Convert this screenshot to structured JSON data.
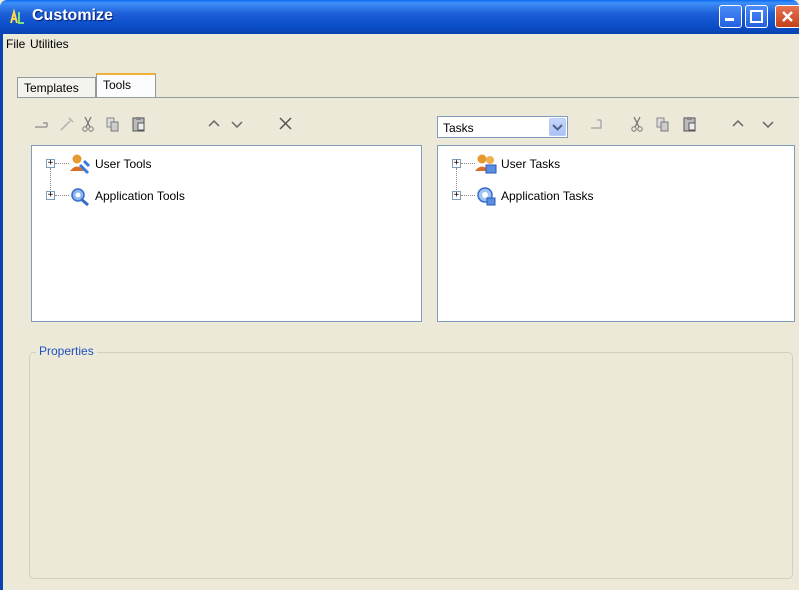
{
  "window": {
    "title": "Customize"
  },
  "menu": {
    "items": [
      "File",
      "Utilities"
    ]
  },
  "tabs": [
    {
      "label": "Templates",
      "active": false
    },
    {
      "label": "Tools",
      "active": true
    }
  ],
  "left_pane": {
    "toolbar_icons": [
      "add-tool-icon",
      "edit-tool-icon",
      "cut-icon",
      "copy-icon",
      "paste-icon",
      "move-up-icon",
      "move-down-icon",
      "delete-icon"
    ],
    "tree": [
      {
        "label": "User Tools",
        "icon": "user-tools-icon"
      },
      {
        "label": "Application Tools",
        "icon": "application-tools-icon"
      }
    ]
  },
  "right_pane": {
    "dropdown_value": "Tasks",
    "toolbar_icons": [
      "add-task-icon",
      "cut-icon",
      "copy-icon",
      "paste-icon",
      "move-up-icon",
      "move-down-icon"
    ],
    "tree": [
      {
        "label": "User Tasks",
        "icon": "user-tasks-icon"
      },
      {
        "label": "Application Tasks",
        "icon": "application-tasks-icon"
      }
    ]
  },
  "properties": {
    "label": "Properties"
  },
  "colors": {
    "titlebar": "#0a4ec8",
    "background": "#ece9d8",
    "group_label": "#2050c0",
    "tab_highlight": "#f0b13b"
  }
}
